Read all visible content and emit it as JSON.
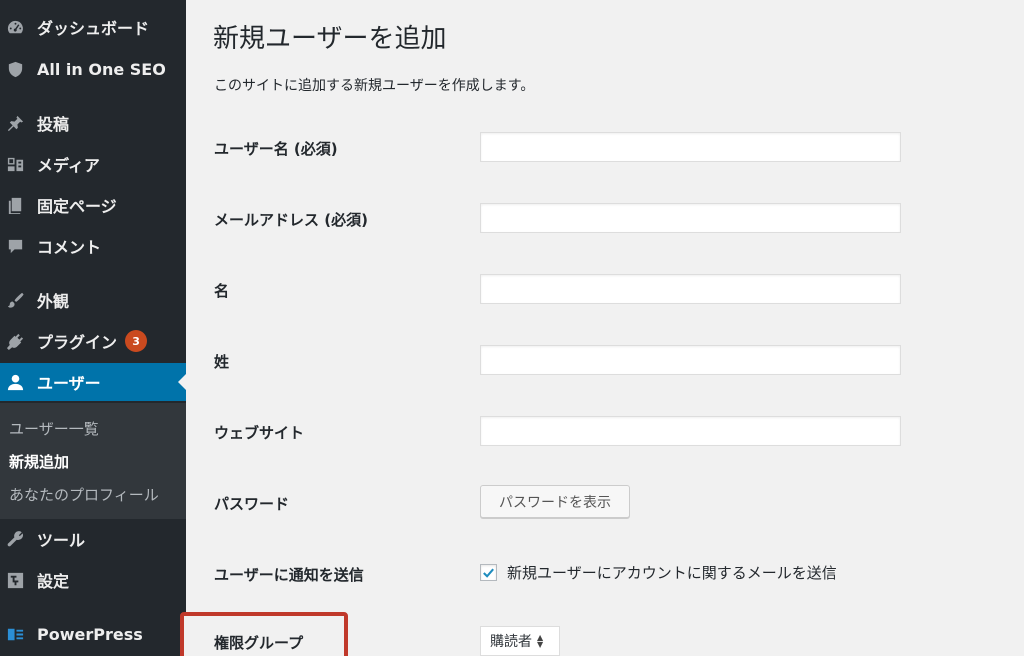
{
  "sidebar": {
    "items": [
      {
        "key": "dashboard",
        "label": "ダッシュボード",
        "icon": "dashboard-icon"
      },
      {
        "key": "aioseo",
        "label": "All in One SEO",
        "icon": "shield-icon"
      },
      {
        "key": "posts",
        "label": "投稿",
        "icon": "pin-icon"
      },
      {
        "key": "media",
        "label": "メディア",
        "icon": "media-icon"
      },
      {
        "key": "pages",
        "label": "固定ページ",
        "icon": "page-icon"
      },
      {
        "key": "comments",
        "label": "コメント",
        "icon": "comment-icon"
      },
      {
        "key": "appearance",
        "label": "外観",
        "icon": "brush-icon"
      },
      {
        "key": "plugins",
        "label": "プラグイン",
        "icon": "plugin-icon",
        "badge": "3"
      },
      {
        "key": "users",
        "label": "ユーザー",
        "icon": "user-icon"
      },
      {
        "key": "tools",
        "label": "ツール",
        "icon": "wrench-icon"
      },
      {
        "key": "settings",
        "label": "設定",
        "icon": "settings-icon"
      },
      {
        "key": "powerpress",
        "label": "PowerPress",
        "icon": "powerpress-icon"
      }
    ],
    "submenu": [
      {
        "label": "ユーザー一覧"
      },
      {
        "label": "新規追加",
        "active": true
      },
      {
        "label": "あなたのプロフィール"
      }
    ]
  },
  "main": {
    "title": "新規ユーザーを追加",
    "description": "このサイトに追加する新規ユーザーを作成します。",
    "fields": [
      {
        "label": "ユーザー名 (必須)",
        "value": ""
      },
      {
        "label": "メールアドレス (必須)",
        "value": ""
      },
      {
        "label": "名",
        "value": ""
      },
      {
        "label": "姓",
        "value": ""
      },
      {
        "label": "ウェブサイト",
        "value": ""
      }
    ],
    "password": {
      "label": "パスワード",
      "button": "パスワードを表示"
    },
    "notify": {
      "label": "ユーザーに通知を送信",
      "checkbox_label": "新規ユーザーにアカウントに関するメールを送信",
      "checked": true
    },
    "role": {
      "label": "権限グループ",
      "selected": "購読者"
    }
  },
  "colors": {
    "sidebar_bg": "#23282d",
    "submenu_bg": "#32373c",
    "current_bg": "#0073aa",
    "badge_bg": "#ca4a1f",
    "highlight_border": "#c0392b",
    "content_bg": "#f1f1f1"
  }
}
